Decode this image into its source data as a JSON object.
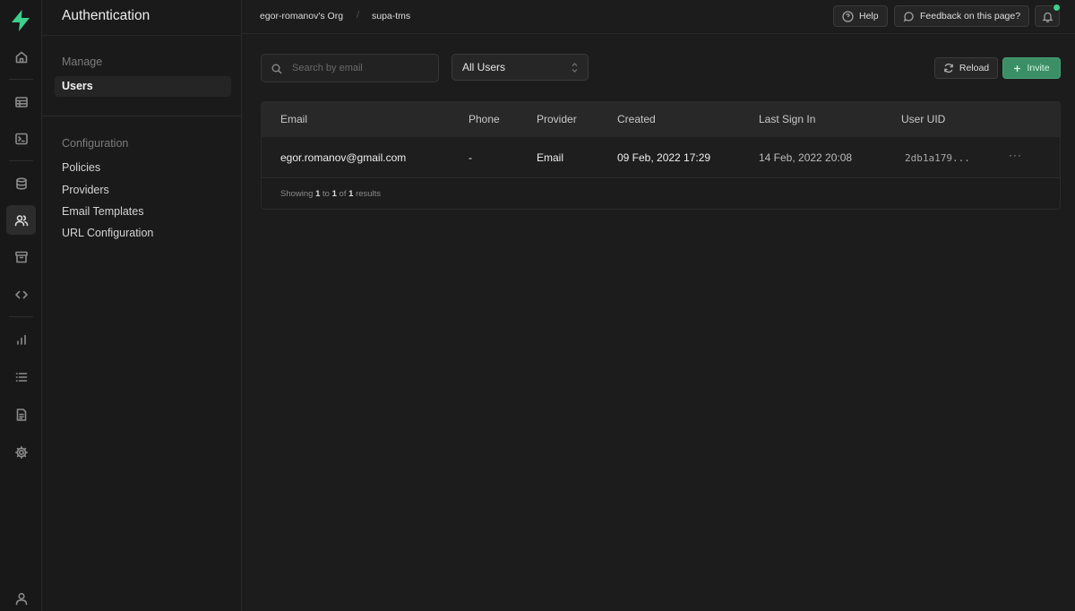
{
  "app": {
    "section_title": "Authentication",
    "brand_color": "#3ecf8e"
  },
  "rail": {
    "icons": [
      "home-icon",
      "table-editor-icon",
      "sql-editor-icon",
      "database-icon",
      "auth-users-icon",
      "storage-icon",
      "api-code-icon",
      "reports-icon",
      "logs-icon",
      "docs-icon",
      "settings-icon",
      "profile-icon"
    ]
  },
  "subnav": {
    "manage_heading": "Manage",
    "users_label": "Users",
    "config_heading": "Configuration",
    "items": [
      "Policies",
      "Providers",
      "Email Templates",
      "URL Configuration"
    ]
  },
  "topbar": {
    "org": "egor-romanov's Org",
    "separator": "/",
    "project": "supa-tms",
    "help_label": "Help",
    "feedback_label": "Feedback on this page?"
  },
  "toolbar": {
    "search_placeholder": "Search by email",
    "filter_value": "All Users",
    "reload_label": "Reload",
    "invite_label": "Invite"
  },
  "table": {
    "columns": [
      "Email",
      "Phone",
      "Provider",
      "Created",
      "Last Sign In",
      "User UID"
    ],
    "rows": [
      {
        "email": "egor.romanov@gmail.com",
        "phone": "-",
        "provider": "Email",
        "created": "09 Feb, 2022 17:29",
        "last_sign_in": "14 Feb, 2022 20:08",
        "uid": "2db1a179...",
        "actions": "···"
      }
    ],
    "footer": {
      "prefix": "Showing",
      "from": "1",
      "to_word": "to",
      "to": "1",
      "of_word": "of",
      "total": "1",
      "suffix": "results"
    }
  }
}
